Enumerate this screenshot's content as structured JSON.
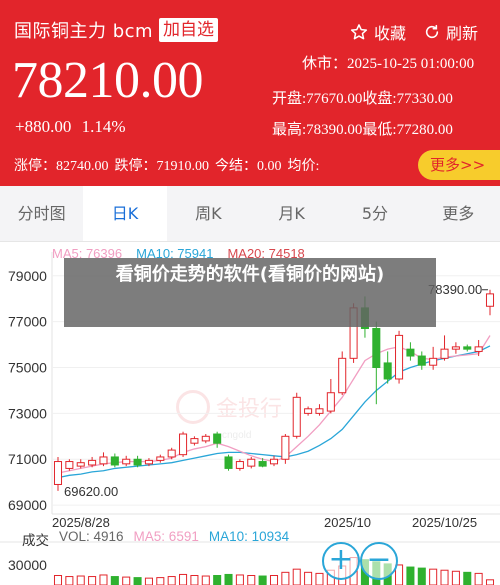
{
  "header": {
    "title": "国际铜主力 bcm",
    "add_watchlist": "加自选",
    "favorite": "收藏",
    "refresh": "刷新",
    "status": "休市：2025-10-25 01:00:00",
    "price": "78210.00",
    "change": "+880.00",
    "change_pct": "1.14%",
    "open": "开盘:77670.00",
    "close": "收盘:77330.00",
    "high": "最高:78390.00",
    "low": "最低:77280.00",
    "limit_up": "涨停：82740.00",
    "limit_down": "跌停：71910.00",
    "settle": "今结：0.00",
    "avg": "均价:",
    "more": "更多>>",
    "accent": "#e2252b"
  },
  "tabs": [
    {
      "label": "分时图"
    },
    {
      "label": "日K",
      "active": true
    },
    {
      "label": "周K"
    },
    {
      "label": "月K"
    },
    {
      "label": "5分"
    },
    {
      "label": "更多"
    }
  ],
  "overlay": {
    "text": "看铜价走势的软件(看铜价的网站)"
  },
  "watermark": {
    "brand": "金投行",
    "sub": "cngold"
  },
  "chart": {
    "ma_legend": {
      "ma5": "MA5: 76396",
      "ma10": "MA10: 75941",
      "ma20": "MA20: 74518"
    },
    "vol_legend": {
      "label": "成交",
      "vol": "VOL: 4916",
      "ma5": "MA5: 6591",
      "ma10": "MA10: 10934"
    },
    "dates": [
      "2025/8/28",
      "2025/10",
      "2025/10/25"
    ],
    "max_label": "78390.00",
    "min_label": "69620.00",
    "vol_tick": "30000"
  },
  "chart_data": {
    "type": "candlestick",
    "y_ticks": [
      79000,
      77000,
      75000,
      73000,
      71000,
      69000
    ],
    "ylim": [
      68700,
      79600
    ],
    "up_color": "#e2252b",
    "down_color": "#2fb12f",
    "candles": [
      {
        "o": 69900,
        "c": 70900,
        "h": 71100,
        "l": 69620
      },
      {
        "o": 70600,
        "c": 70900,
        "h": 71000,
        "l": 70500
      },
      {
        "o": 70700,
        "c": 70850,
        "h": 71000,
        "l": 70600
      },
      {
        "o": 70750,
        "c": 70950,
        "h": 71100,
        "l": 70650
      },
      {
        "o": 70800,
        "c": 71100,
        "h": 71300,
        "l": 70700
      },
      {
        "o": 71100,
        "c": 70750,
        "h": 71250,
        "l": 70650
      },
      {
        "o": 70800,
        "c": 71000,
        "h": 71150,
        "l": 70700
      },
      {
        "o": 71000,
        "c": 70750,
        "h": 71150,
        "l": 70650
      },
      {
        "o": 70800,
        "c": 70950,
        "h": 71050,
        "l": 70700
      },
      {
        "o": 70950,
        "c": 71100,
        "h": 71200,
        "l": 70850
      },
      {
        "o": 71100,
        "c": 71400,
        "h": 71500,
        "l": 71000
      },
      {
        "o": 71200,
        "c": 72100,
        "h": 72200,
        "l": 71100
      },
      {
        "o": 71700,
        "c": 71900,
        "h": 72000,
        "l": 71600
      },
      {
        "o": 71800,
        "c": 72000,
        "h": 72100,
        "l": 71700
      },
      {
        "o": 72100,
        "c": 71700,
        "h": 72200,
        "l": 71500
      },
      {
        "o": 71100,
        "c": 70600,
        "h": 71200,
        "l": 70500
      },
      {
        "o": 70600,
        "c": 70900,
        "h": 71000,
        "l": 70500
      },
      {
        "o": 70700,
        "c": 71000,
        "h": 71100,
        "l": 70600
      },
      {
        "o": 70900,
        "c": 70700,
        "h": 71050,
        "l": 70650
      },
      {
        "o": 70800,
        "c": 71000,
        "h": 71150,
        "l": 70700
      },
      {
        "o": 71000,
        "c": 72000,
        "h": 72100,
        "l": 70800
      },
      {
        "o": 72000,
        "c": 73700,
        "h": 73900,
        "l": 71900
      },
      {
        "o": 73000,
        "c": 73200,
        "h": 73300,
        "l": 72900
      },
      {
        "o": 73000,
        "c": 73200,
        "h": 73400,
        "l": 72900
      },
      {
        "o": 73100,
        "c": 73900,
        "h": 74500,
        "l": 73000
      },
      {
        "o": 73900,
        "c": 75400,
        "h": 75700,
        "l": 73800
      },
      {
        "o": 75400,
        "c": 77600,
        "h": 77800,
        "l": 75200
      },
      {
        "o": 77600,
        "c": 76700,
        "h": 78100,
        "l": 76300
      },
      {
        "o": 76700,
        "c": 75000,
        "h": 77000,
        "l": 73400
      },
      {
        "o": 75200,
        "c": 74500,
        "h": 75700,
        "l": 74300
      },
      {
        "o": 74500,
        "c": 76400,
        "h": 76600,
        "l": 74300
      },
      {
        "o": 75800,
        "c": 75500,
        "h": 76100,
        "l": 75300
      },
      {
        "o": 75500,
        "c": 75100,
        "h": 75700,
        "l": 74900
      },
      {
        "o": 75100,
        "c": 75400,
        "h": 75900,
        "l": 74900
      },
      {
        "o": 75400,
        "c": 75800,
        "h": 76400,
        "l": 75300
      },
      {
        "o": 75800,
        "c": 75900,
        "h": 76100,
        "l": 75600
      },
      {
        "o": 75900,
        "c": 75800,
        "h": 76000,
        "l": 75700
      },
      {
        "o": 75700,
        "c": 75900,
        "h": 76200,
        "l": 75500
      },
      {
        "o": 77670,
        "c": 78210,
        "h": 78390,
        "l": 77280
      }
    ],
    "ma5": [
      70400,
      70500,
      70600,
      70700,
      70800,
      70850,
      70900,
      70900,
      70900,
      70950,
      71050,
      71300,
      71450,
      71550,
      71700,
      71550,
      71350,
      71150,
      71000,
      70900,
      71100,
      71550,
      72000,
      72500,
      73100,
      73700,
      74500,
      75300,
      75600,
      75800,
      75900,
      75700,
      75400,
      75350,
      75450,
      75500,
      75550,
      75600,
      76396
    ],
    "ma10": [
      70200,
      70300,
      70350,
      70450,
      70500,
      70600,
      70650,
      70700,
      70750,
      70800,
      70850,
      70950,
      71050,
      71150,
      71250,
      71300,
      71300,
      71250,
      71200,
      71150,
      71100,
      71200,
      71350,
      71600,
      71900,
      72300,
      72900,
      73500,
      74000,
      74400,
      74800,
      75000,
      75150,
      75300,
      75400,
      75500,
      75600,
      75700,
      75941
    ]
  },
  "volume": {
    "ylim": [
      0,
      36000
    ],
    "values": [
      9000,
      8000,
      8500,
      8000,
      9500,
      8000,
      7500,
      7000,
      6500,
      7000,
      8000,
      10000,
      9000,
      8500,
      9000,
      10000,
      9500,
      9000,
      8500,
      9000,
      12000,
      15000,
      12000,
      11000,
      14000,
      18000,
      26000,
      24000,
      22000,
      20000,
      19000,
      17000,
      16000,
      15000,
      14000,
      13000,
      12000,
      11000,
      4916
    ],
    "up": [
      1,
      1,
      1,
      1,
      1,
      0,
      1,
      0,
      1,
      1,
      1,
      1,
      1,
      1,
      0,
      0,
      1,
      1,
      0,
      1,
      1,
      1,
      1,
      1,
      1,
      1,
      1,
      0,
      0,
      0,
      1,
      0,
      0,
      1,
      1,
      1,
      0,
      1,
      1
    ]
  }
}
